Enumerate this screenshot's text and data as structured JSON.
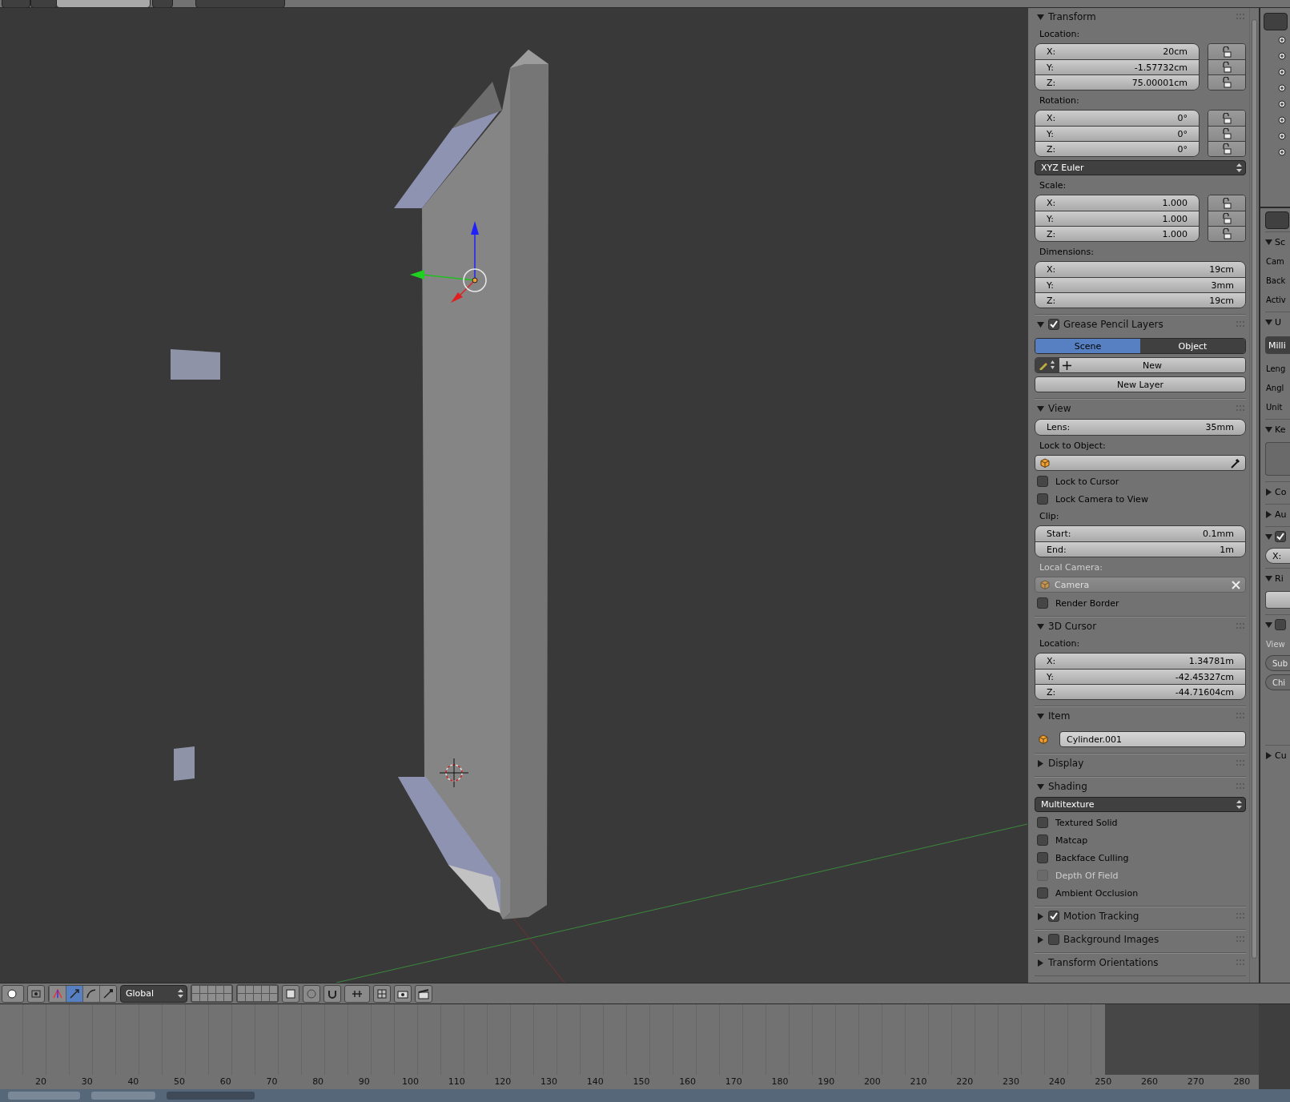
{
  "toolbar": {
    "orientation_dropdown": "Global"
  },
  "n_panel": {
    "sections": [
      {
        "title": "Transform",
        "expanded": true,
        "rows": [
          {
            "kind": "label",
            "text": "Location:",
            "disabled": false
          },
          {
            "kind": "vector",
            "fields": [
              {
                "label": "X:",
                "value": "20cm",
                "locked": false
              },
              {
                "label": "Y:",
                "value": "-1.57732cm",
                "locked": false
              },
              {
                "label": "Z:",
                "value": "75.00001cm",
                "locked": false
              }
            ]
          },
          {
            "kind": "label",
            "text": "Rotation:",
            "disabled": false
          },
          {
            "kind": "vector",
            "fields": [
              {
                "label": "X:",
                "value": "0°",
                "locked": false
              },
              {
                "label": "Y:",
                "value": "0°",
                "locked": false
              },
              {
                "label": "Z:",
                "value": "0°",
                "locked": false
              }
            ]
          },
          {
            "kind": "dropdown",
            "value": "XYZ Euler"
          },
          {
            "kind": "label",
            "text": "Scale:",
            "disabled": false
          },
          {
            "kind": "vector",
            "fields": [
              {
                "label": "X:",
                "value": "1.000",
                "locked": false
              },
              {
                "label": "Y:",
                "value": "1.000",
                "locked": false
              },
              {
                "label": "Z:",
                "value": "1.000",
                "locked": false
              }
            ]
          },
          {
            "kind": "label",
            "text": "Dimensions:",
            "disabled": false
          },
          {
            "kind": "vector",
            "fields": [
              {
                "label": "X:",
                "value": "19cm"
              },
              {
                "label": "Y:",
                "value": "3mm"
              },
              {
                "label": "Z:",
                "value": "19cm"
              }
            ]
          }
        ]
      },
      {
        "title": "Grease Pencil Layers",
        "expanded": true,
        "enabled": true,
        "rows": [
          {
            "kind": "toggle",
            "options": [
              {
                "label": "Scene",
                "selected": true
              },
              {
                "label": "Object",
                "selected": false
              }
            ]
          },
          {
            "kind": "new-datablock",
            "text": "New"
          },
          {
            "kind": "button",
            "text": "New Layer"
          }
        ]
      },
      {
        "title": "View",
        "expanded": true,
        "rows": [
          {
            "kind": "vector",
            "fields": [
              {
                "label": "Lens:",
                "value": "35mm"
              }
            ]
          },
          {
            "kind": "label",
            "text": "Lock to Object:",
            "disabled": false
          },
          {
            "kind": "object-field",
            "disabled": false
          },
          {
            "kind": "checkbox",
            "text": "Lock to Cursor",
            "checked": false,
            "disabled": false
          },
          {
            "kind": "checkbox",
            "text": "Lock Camera to View",
            "checked": false,
            "disabled": false
          },
          {
            "kind": "label",
            "text": "Clip:",
            "disabled": false
          },
          {
            "kind": "vector",
            "fields": [
              {
                "label": "Start:",
                "value": "0.1mm"
              },
              {
                "label": "End:",
                "value": "1m"
              }
            ]
          },
          {
            "kind": "label",
            "text": "Local Camera:",
            "disabled": true
          },
          {
            "kind": "object-field",
            "value": "Camera",
            "disabled": true
          },
          {
            "kind": "checkbox",
            "text": "Render Border",
            "checked": false,
            "disabled": false
          }
        ]
      },
      {
        "title": "3D Cursor",
        "expanded": true,
        "rows": [
          {
            "kind": "label",
            "text": "Location:",
            "disabled": false
          },
          {
            "kind": "vector",
            "fields": [
              {
                "label": "X:",
                "value": "1.34781m"
              },
              {
                "label": "Y:",
                "value": "-42.45327cm"
              },
              {
                "label": "Z:",
                "value": "-44.71604cm"
              }
            ]
          }
        ]
      },
      {
        "title": "Item",
        "expanded": true,
        "rows": [
          {
            "kind": "name-field",
            "value": "Cylinder.001"
          }
        ]
      },
      {
        "title": "Display",
        "expanded": false
      },
      {
        "title": "Shading",
        "expanded": true,
        "rows": [
          {
            "kind": "dropdown",
            "value": "Multitexture"
          },
          {
            "kind": "checkbox",
            "text": "Textured Solid",
            "checked": false,
            "disabled": false
          },
          {
            "kind": "checkbox",
            "text": "Matcap",
            "checked": false,
            "disabled": false
          },
          {
            "kind": "checkbox",
            "text": "Backface Culling",
            "checked": false,
            "disabled": false
          },
          {
            "kind": "checkbox",
            "text": "Depth Of Field",
            "checked": false,
            "disabled": true
          },
          {
            "kind": "checkbox",
            "text": "Ambient Occlusion",
            "checked": false,
            "disabled": false
          }
        ]
      },
      {
        "title": "Motion Tracking",
        "expanded": false,
        "enabled": true
      },
      {
        "title": "Background Images",
        "expanded": false,
        "enabled": false
      },
      {
        "title": "Transform Orientations",
        "expanded": false
      }
    ]
  },
  "properties_strip": {
    "items": [
      {
        "kind": "panel",
        "text": "Sc",
        "expanded": true
      },
      {
        "kind": "label",
        "text": "Cam",
        "disabled": false
      },
      {
        "kind": "label",
        "text": "Back",
        "disabled": false
      },
      {
        "kind": "label",
        "text": "Activ",
        "disabled": false
      },
      {
        "kind": "panel",
        "text": "U",
        "expanded": true
      },
      {
        "kind": "dropdown",
        "text": "Milli"
      },
      {
        "kind": "label",
        "text": "Leng",
        "disabled": false
      },
      {
        "kind": "label",
        "text": "Angl",
        "disabled": false
      },
      {
        "kind": "label",
        "text": "Unit",
        "disabled": false
      },
      {
        "kind": "panel",
        "text": "Ke",
        "expanded": true
      },
      {
        "kind": "list"
      },
      {
        "kind": "panel",
        "text": "Co",
        "expanded": false
      },
      {
        "kind": "panel",
        "text": "Au",
        "expanded": false
      },
      {
        "kind": "panel",
        "expanded": true,
        "checked": true
      },
      {
        "kind": "field",
        "text": "X:",
        "disabled": false
      },
      {
        "kind": "panel",
        "text": "Ri",
        "expanded": true
      },
      {
        "kind": "button"
      },
      {
        "kind": "panel",
        "expanded": true,
        "checked": false
      },
      {
        "kind": "label",
        "text": "View",
        "disabled": true
      },
      {
        "kind": "field",
        "text": "Sub",
        "disabled": true
      },
      {
        "kind": "field",
        "text": "Chi",
        "disabled": true
      },
      {
        "kind": "panel",
        "text": "Cu",
        "expanded": false
      }
    ]
  },
  "timeline": {
    "ruler": [
      "20",
      "30",
      "40",
      "50",
      "60",
      "70",
      "80",
      "90",
      "100",
      "110",
      "120",
      "130",
      "140",
      "150",
      "160",
      "170",
      "180",
      "190",
      "200",
      "210",
      "220",
      "230",
      "240",
      "250",
      "260",
      "270",
      "280"
    ]
  }
}
